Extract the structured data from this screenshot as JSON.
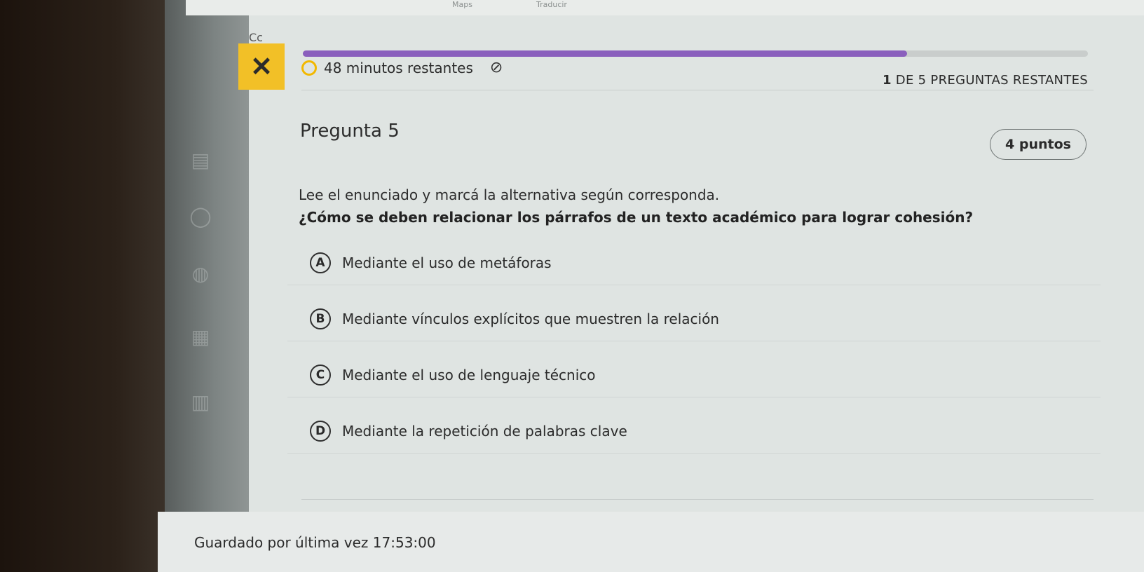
{
  "topbar": {
    "items": [
      "Maps",
      "Traducir"
    ]
  },
  "header_fragment": "Cc",
  "quiz": {
    "progress_fraction": 0.77,
    "timer_text": "48 minutos restantes",
    "remaining_count": "1",
    "remaining_label": " DE 5 PREGUNTAS RESTANTES"
  },
  "question": {
    "title": "Pregunta 5",
    "points": "4 puntos",
    "instruction": "Lee el enunciado y marcá la alternativa según corresponda.",
    "text": "¿Cómo se deben relacionar los párrafos de un texto académico para lograr cohesión?",
    "options": [
      {
        "letter": "A",
        "text": "Mediante el uso de metáforas"
      },
      {
        "letter": "B",
        "text": "Mediante vínculos explícitos que muestren la relación"
      },
      {
        "letter": "C",
        "text": "Mediante el uso de lenguaje técnico"
      },
      {
        "letter": "D",
        "text": "Mediante la repetición de palabras clave"
      }
    ]
  },
  "footer": {
    "saved_text": "Guardado por última vez 17:53:00"
  },
  "colors": {
    "accent": "#8a5fbd",
    "close_button": "#f2c027",
    "timer_icon": "#f2b800"
  },
  "icons": {
    "close": "close-icon",
    "timer": "timer-icon",
    "hide": "hide-eye-icon"
  }
}
